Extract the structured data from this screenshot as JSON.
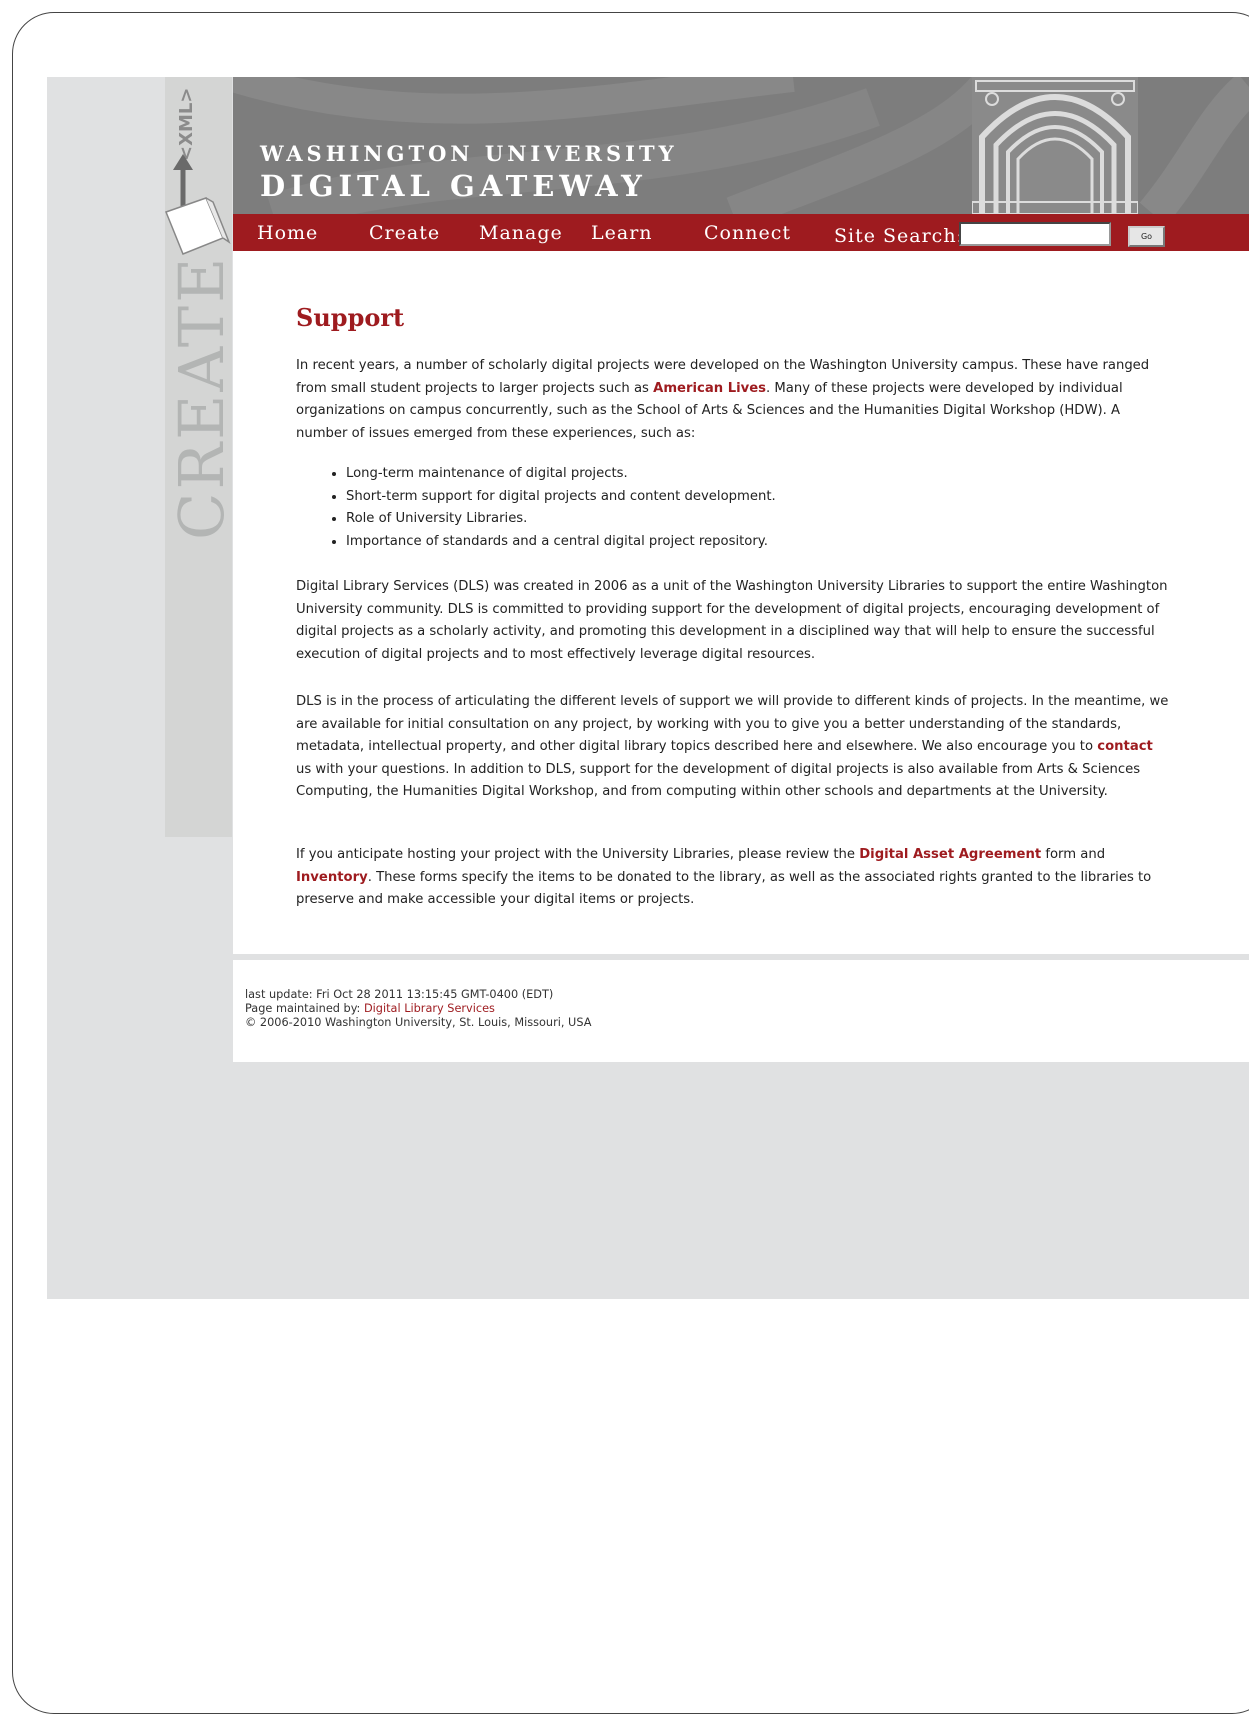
{
  "side": {
    "xml_label": "<XML>",
    "create_label": "CREATE"
  },
  "header": {
    "title_line1": "WASHINGTON UNIVERSITY",
    "title_line2": "DIGITAL GATEWAY"
  },
  "nav": {
    "items": [
      "Home",
      "Create",
      "Manage",
      "Learn",
      "Connect"
    ],
    "search_label": "Site Search:",
    "search_value": "",
    "go_label": "Go"
  },
  "main": {
    "title": "Support",
    "p1_a": "In recent years, a number of scholarly digital projects were developed on the Washington University campus. These have ranged from small student projects to larger projects such as ",
    "p1_link": "American Lives",
    "p1_b": ". Many of these projects were developed by individual organizations on campus concurrently, such as the School of Arts & Sciences and the Humanities Digital Workshop (HDW). A number of issues emerged from these experiences, such as:",
    "bullets": [
      "Long-term maintenance of digital projects.",
      "Short-term support for digital projects and content development.",
      "Role of University Libraries.",
      "Importance of standards and a central digital project repository."
    ],
    "p2": "Digital Library Services (DLS) was created in 2006 as a unit of the Washington University Libraries to support the entire Washington University community. DLS is committed to providing support for the development of digital projects, encouraging development of digital projects as a scholarly activity, and promoting this development in a disciplined way that will help to ensure the successful execution of digital projects and to most effectively leverage digital resources.",
    "p3_a": "DLS is in the process of articulating the different levels of support we will provide to different kinds of projects. In the meantime, we are available for initial consultation on any project, by working with you to give you a better understanding of the standards, metadata, intellectual property, and other digital library topics described here and elsewhere. We also encourage you to ",
    "p3_link": "contact",
    "p3_b": " us with your questions. In addition to DLS, support for the development of digital projects is also available from Arts & Sciences Computing, the Humanities Digital Workshop, and from computing within other schools and departments at the University.",
    "p4_a": "If you anticipate hosting your project with the University Libraries, please review the ",
    "p4_link1": "Digital Asset Agreement",
    "p4_mid": " form and ",
    "p4_link2": "Inventory",
    "p4_b": ". These forms specify the items to be donated to the library, as well as the associated rights granted to the libraries to preserve and make accessible your digital items or projects."
  },
  "footer": {
    "last_update": "last update: Fri Oct 28 2011 13:15:45 GMT-0400 (EDT)",
    "maintained_prefix": "Page maintained by: ",
    "maintained_link": "Digital Library Services",
    "copyright": "© 2006-2010 Washington University, St. Louis, Missouri, USA"
  },
  "colors": {
    "accent_red": "#9e1b1f",
    "header_gray": "#7d7d7d",
    "page_gray": "#e0e1e2"
  }
}
